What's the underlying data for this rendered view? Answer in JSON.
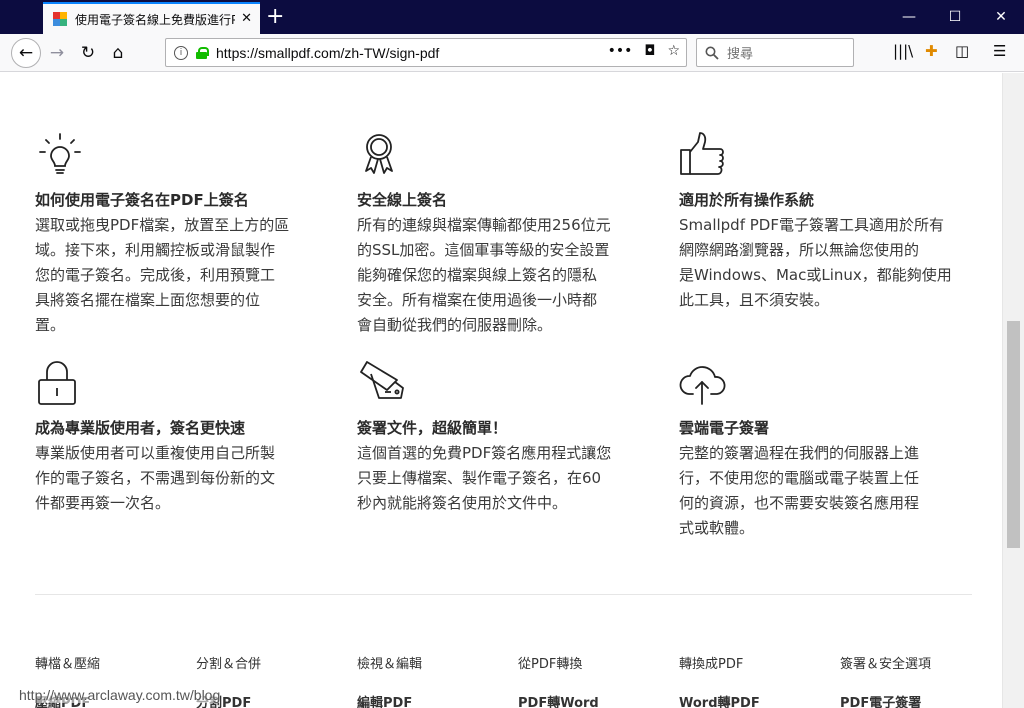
{
  "browser": {
    "tab_title": "使用電子簽名線上免費版進行PDF",
    "url": "https://smallpdf.com/zh-TW/sign-pdf",
    "search_placeholder": "搜尋",
    "page_actions": "•••"
  },
  "features": [
    {
      "icon": "lightbulb-icon",
      "title": "如何使用電子簽名在PDF上簽名",
      "lines": [
        "選取或拖曳PDF檔案，放置至上方的區",
        "域。接下來，利用觸控板或滑鼠製作",
        "您的電子簽名。完成後，利用預覽工",
        "具將簽名擺在檔案上面您想要的位",
        "置。"
      ]
    },
    {
      "icon": "award-ribbon-icon",
      "title": "安全線上簽名",
      "lines": [
        "所有的連線與檔案傳輸都使用256位元",
        "的SSL加密。這個軍事等級的安全設置",
        "能夠確保您的檔案與線上簽名的隱私",
        "安全。所有檔案在使用過後一小時都",
        "會自動從我們的伺服器刪除。"
      ]
    },
    {
      "icon": "thumbs-up-icon",
      "title": "適用於所有操作系統",
      "lines": [
        "Smallpdf PDF電子簽署工具適用於所有",
        "網際網路瀏覽器，所以無論您使用的",
        "是Windows、Mac或Linux，都能夠使用",
        "此工具，且不須安裝。"
      ]
    },
    {
      "icon": "padlock-icon",
      "title": "成為專業版使用者，簽名更快速",
      "lines": [
        "專業版使用者可以重複使用自己所製",
        "作的電子簽名，不需遇到每份新的文",
        "件都要再簽一次名。"
      ]
    },
    {
      "icon": "pocket-knife-icon",
      "title": "簽署文件，超級簡單！",
      "lines": [
        "這個首選的免費PDF簽名應用程式讓您",
        "只要上傳檔案、製作電子簽名，在60",
        "秒內就能將簽名使用於文件中。"
      ]
    },
    {
      "icon": "cloud-upload-icon",
      "title": "雲端電子簽署",
      "lines": [
        "完整的簽署過程在我們的伺服器上進",
        "行，不使用您的電腦或電子裝置上任",
        "何的資源，也不需要安裝簽名應用程",
        "式或軟體。"
      ]
    }
  ],
  "footer": {
    "headings": [
      "轉檔＆壓縮",
      "分割＆合併",
      "檢視＆編輯",
      "從PDF轉換",
      "轉換成PDF",
      "簽署＆安全選項"
    ],
    "links": [
      "壓縮PDF",
      "分割PDF",
      "編輯PDF",
      "PDF轉Word",
      "Word轉PDF",
      "PDF電子簽署"
    ]
  },
  "watermark": "http://www.arclaway.com.tw/blog"
}
